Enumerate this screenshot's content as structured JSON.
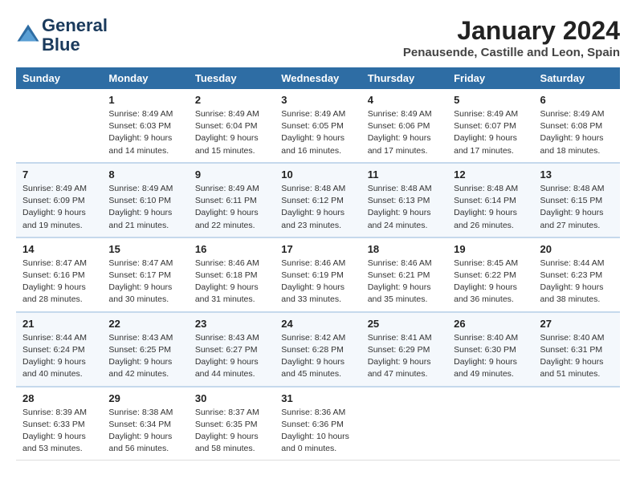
{
  "logo": {
    "line1": "General",
    "line2": "Blue"
  },
  "title": "January 2024",
  "location": "Penausende, Castille and Leon, Spain",
  "weekdays": [
    "Sunday",
    "Monday",
    "Tuesday",
    "Wednesday",
    "Thursday",
    "Friday",
    "Saturday"
  ],
  "weeks": [
    [
      {
        "date": "",
        "sunrise": "",
        "sunset": "",
        "daylight": ""
      },
      {
        "date": "1",
        "sunrise": "Sunrise: 8:49 AM",
        "sunset": "Sunset: 6:03 PM",
        "daylight": "Daylight: 9 hours and 14 minutes."
      },
      {
        "date": "2",
        "sunrise": "Sunrise: 8:49 AM",
        "sunset": "Sunset: 6:04 PM",
        "daylight": "Daylight: 9 hours and 15 minutes."
      },
      {
        "date": "3",
        "sunrise": "Sunrise: 8:49 AM",
        "sunset": "Sunset: 6:05 PM",
        "daylight": "Daylight: 9 hours and 16 minutes."
      },
      {
        "date": "4",
        "sunrise": "Sunrise: 8:49 AM",
        "sunset": "Sunset: 6:06 PM",
        "daylight": "Daylight: 9 hours and 17 minutes."
      },
      {
        "date": "5",
        "sunrise": "Sunrise: 8:49 AM",
        "sunset": "Sunset: 6:07 PM",
        "daylight": "Daylight: 9 hours and 17 minutes."
      },
      {
        "date": "6",
        "sunrise": "Sunrise: 8:49 AM",
        "sunset": "Sunset: 6:08 PM",
        "daylight": "Daylight: 9 hours and 18 minutes."
      }
    ],
    [
      {
        "date": "7",
        "sunrise": "Sunrise: 8:49 AM",
        "sunset": "Sunset: 6:09 PM",
        "daylight": "Daylight: 9 hours and 19 minutes."
      },
      {
        "date": "8",
        "sunrise": "Sunrise: 8:49 AM",
        "sunset": "Sunset: 6:10 PM",
        "daylight": "Daylight: 9 hours and 21 minutes."
      },
      {
        "date": "9",
        "sunrise": "Sunrise: 8:49 AM",
        "sunset": "Sunset: 6:11 PM",
        "daylight": "Daylight: 9 hours and 22 minutes."
      },
      {
        "date": "10",
        "sunrise": "Sunrise: 8:48 AM",
        "sunset": "Sunset: 6:12 PM",
        "daylight": "Daylight: 9 hours and 23 minutes."
      },
      {
        "date": "11",
        "sunrise": "Sunrise: 8:48 AM",
        "sunset": "Sunset: 6:13 PM",
        "daylight": "Daylight: 9 hours and 24 minutes."
      },
      {
        "date": "12",
        "sunrise": "Sunrise: 8:48 AM",
        "sunset": "Sunset: 6:14 PM",
        "daylight": "Daylight: 9 hours and 26 minutes."
      },
      {
        "date": "13",
        "sunrise": "Sunrise: 8:48 AM",
        "sunset": "Sunset: 6:15 PM",
        "daylight": "Daylight: 9 hours and 27 minutes."
      }
    ],
    [
      {
        "date": "14",
        "sunrise": "Sunrise: 8:47 AM",
        "sunset": "Sunset: 6:16 PM",
        "daylight": "Daylight: 9 hours and 28 minutes."
      },
      {
        "date": "15",
        "sunrise": "Sunrise: 8:47 AM",
        "sunset": "Sunset: 6:17 PM",
        "daylight": "Daylight: 9 hours and 30 minutes."
      },
      {
        "date": "16",
        "sunrise": "Sunrise: 8:46 AM",
        "sunset": "Sunset: 6:18 PM",
        "daylight": "Daylight: 9 hours and 31 minutes."
      },
      {
        "date": "17",
        "sunrise": "Sunrise: 8:46 AM",
        "sunset": "Sunset: 6:19 PM",
        "daylight": "Daylight: 9 hours and 33 minutes."
      },
      {
        "date": "18",
        "sunrise": "Sunrise: 8:46 AM",
        "sunset": "Sunset: 6:21 PM",
        "daylight": "Daylight: 9 hours and 35 minutes."
      },
      {
        "date": "19",
        "sunrise": "Sunrise: 8:45 AM",
        "sunset": "Sunset: 6:22 PM",
        "daylight": "Daylight: 9 hours and 36 minutes."
      },
      {
        "date": "20",
        "sunrise": "Sunrise: 8:44 AM",
        "sunset": "Sunset: 6:23 PM",
        "daylight": "Daylight: 9 hours and 38 minutes."
      }
    ],
    [
      {
        "date": "21",
        "sunrise": "Sunrise: 8:44 AM",
        "sunset": "Sunset: 6:24 PM",
        "daylight": "Daylight: 9 hours and 40 minutes."
      },
      {
        "date": "22",
        "sunrise": "Sunrise: 8:43 AM",
        "sunset": "Sunset: 6:25 PM",
        "daylight": "Daylight: 9 hours and 42 minutes."
      },
      {
        "date": "23",
        "sunrise": "Sunrise: 8:43 AM",
        "sunset": "Sunset: 6:27 PM",
        "daylight": "Daylight: 9 hours and 44 minutes."
      },
      {
        "date": "24",
        "sunrise": "Sunrise: 8:42 AM",
        "sunset": "Sunset: 6:28 PM",
        "daylight": "Daylight: 9 hours and 45 minutes."
      },
      {
        "date": "25",
        "sunrise": "Sunrise: 8:41 AM",
        "sunset": "Sunset: 6:29 PM",
        "daylight": "Daylight: 9 hours and 47 minutes."
      },
      {
        "date": "26",
        "sunrise": "Sunrise: 8:40 AM",
        "sunset": "Sunset: 6:30 PM",
        "daylight": "Daylight: 9 hours and 49 minutes."
      },
      {
        "date": "27",
        "sunrise": "Sunrise: 8:40 AM",
        "sunset": "Sunset: 6:31 PM",
        "daylight": "Daylight: 9 hours and 51 minutes."
      }
    ],
    [
      {
        "date": "28",
        "sunrise": "Sunrise: 8:39 AM",
        "sunset": "Sunset: 6:33 PM",
        "daylight": "Daylight: 9 hours and 53 minutes."
      },
      {
        "date": "29",
        "sunrise": "Sunrise: 8:38 AM",
        "sunset": "Sunset: 6:34 PM",
        "daylight": "Daylight: 9 hours and 56 minutes."
      },
      {
        "date": "30",
        "sunrise": "Sunrise: 8:37 AM",
        "sunset": "Sunset: 6:35 PM",
        "daylight": "Daylight: 9 hours and 58 minutes."
      },
      {
        "date": "31",
        "sunrise": "Sunrise: 8:36 AM",
        "sunset": "Sunset: 6:36 PM",
        "daylight": "Daylight: 10 hours and 0 minutes."
      },
      {
        "date": "",
        "sunrise": "",
        "sunset": "",
        "daylight": ""
      },
      {
        "date": "",
        "sunrise": "",
        "sunset": "",
        "daylight": ""
      },
      {
        "date": "",
        "sunrise": "",
        "sunset": "",
        "daylight": ""
      }
    ]
  ]
}
